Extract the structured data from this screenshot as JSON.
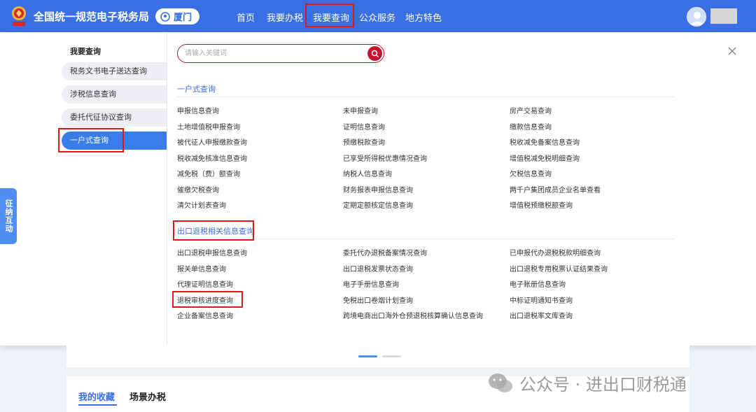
{
  "header": {
    "site_title": "全国统一规范电子税务局",
    "city": "厦门",
    "nav": [
      "首页",
      "我要办税",
      "我要查询",
      "公众服务",
      "地方特色"
    ],
    "active_nav": "我要查询"
  },
  "left_nav": {
    "heading": "我要查询",
    "items": [
      "税务文书电子送达查询",
      "涉税信息查询",
      "委托代征协议查询",
      "一户式查询"
    ],
    "active_item": "一户式查询"
  },
  "search": {
    "placeholder": "请输入关键词",
    "value": ""
  },
  "sections": [
    {
      "title": "一户式查询",
      "links": [
        [
          "申报信息查询",
          "未申报查询",
          "房产交易查询"
        ],
        [
          "土地增值税申报查询",
          "证明信息查询",
          "缴款信息查询"
        ],
        [
          "被代征人申报缴款查询",
          "预缴税款查询",
          "税收减免备案信息查询"
        ],
        [
          "税收减免核准信息查询",
          "已享受所得税优惠情况查询",
          "增值税减免税明细查询"
        ],
        [
          "减免税（费）额查询",
          "纳税人信息查询",
          "欠税信息查询"
        ],
        [
          "催缴欠税查询",
          "财务报表申报信息查询",
          "两千户集团成员企业名单查看"
        ],
        [
          "清欠计划表查询",
          "定期定额核定信息查询",
          "增值税预缴税额查询"
        ]
      ]
    },
    {
      "title": "出口退税相关信息查询",
      "links": [
        [
          "出口退税申报信息查询",
          "委托代办退税备案情况查询",
          "已申报代办退税税款明细查询"
        ],
        [
          "报关单信息查询",
          "出口退税发票状态查询",
          "出口退税专用税票认证结果查询"
        ],
        [
          "代理证明信息查询",
          "电子手册信息查询",
          "电子账册信息查询"
        ],
        [
          "退税审核进度查询",
          "免税出口卷烟计划查询",
          "中标证明通知书查询"
        ],
        [
          "企业备案信息查询",
          "跨境电商出口海外仓预退税核算确认信息查询",
          "出口退税率文库查询"
        ]
      ]
    }
  ],
  "side_tab": "征纳互动",
  "favorites": {
    "tabs": [
      "我的收藏",
      "场景办税"
    ],
    "active": "我的收藏"
  },
  "watermark": "公众号 · 进出口财税通",
  "colors": {
    "primary": "#3a6fe4",
    "highlight_box": "#e5161b",
    "search_red": "#c8102e"
  }
}
